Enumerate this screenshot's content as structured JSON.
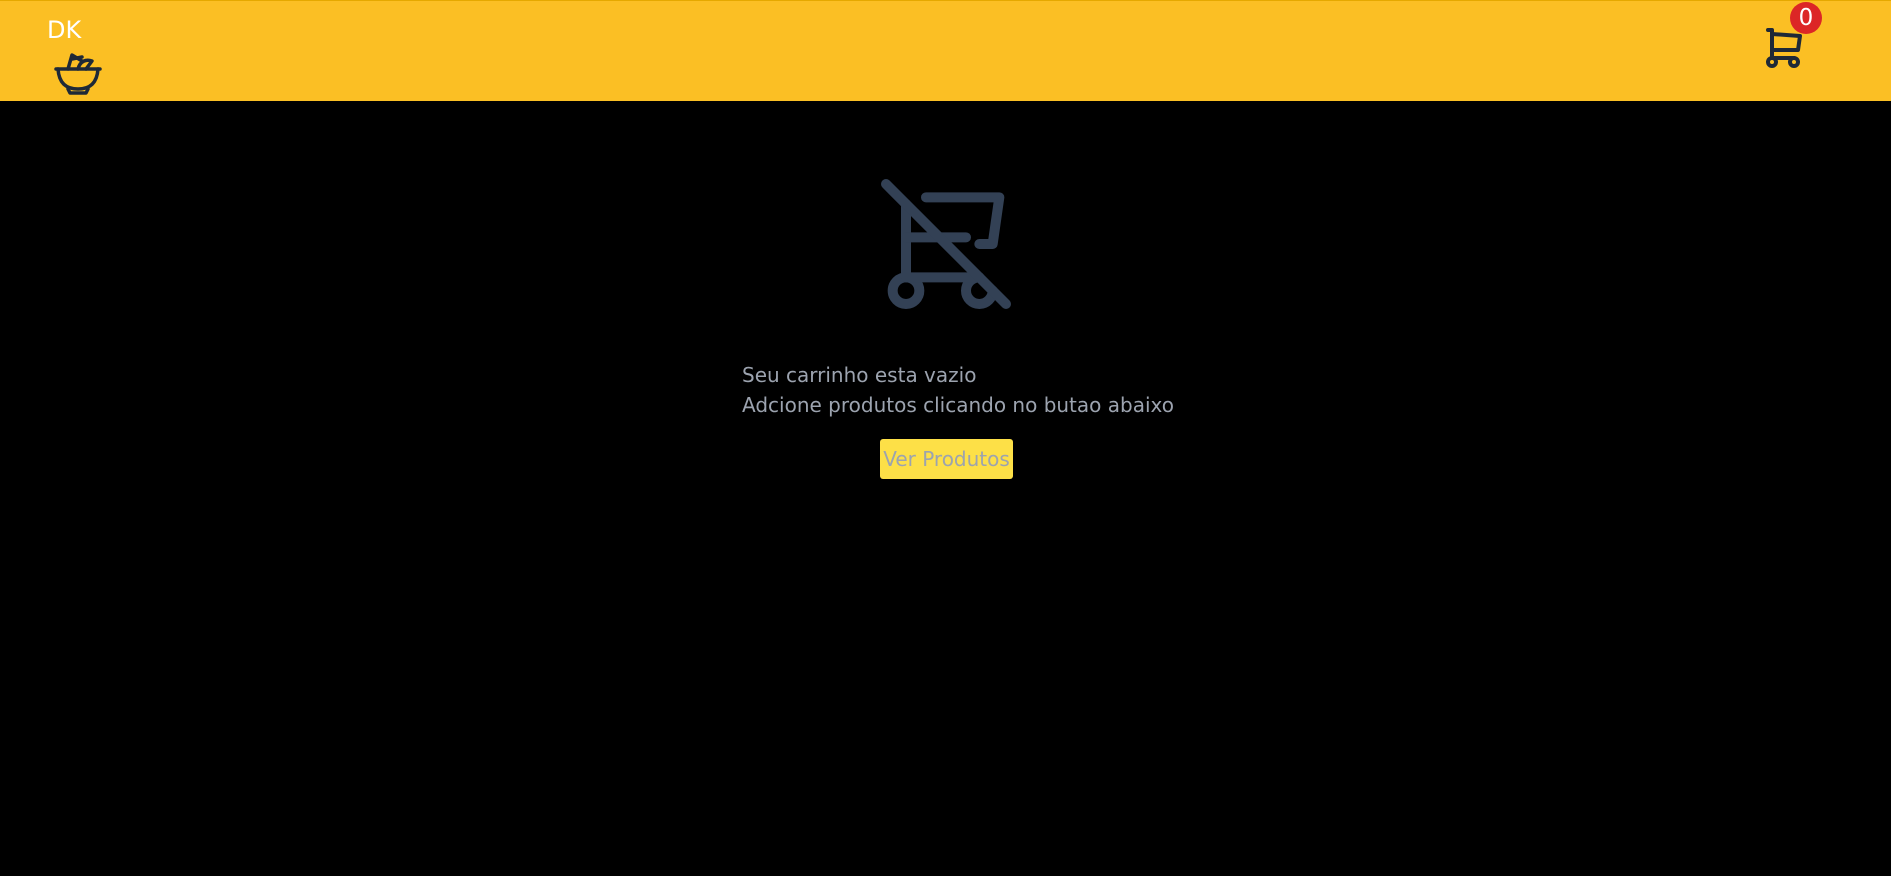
{
  "header": {
    "brand_text": "DK",
    "brand_icon": "bowl-icon",
    "cart_icon": "cart-icon",
    "cart_count": "0",
    "background_color": "#fbbf24",
    "badge_color": "#dc2626"
  },
  "main": {
    "empty_icon": "cart-off-icon",
    "empty_title": "Seu carrinho esta vazio",
    "empty_subtitle": "Adcione produtos clicando no butao abaixo",
    "cta_label": "Ver Produtos",
    "cta_color": "#fde047",
    "text_color": "#9ca3af",
    "icon_color": "#334155"
  }
}
